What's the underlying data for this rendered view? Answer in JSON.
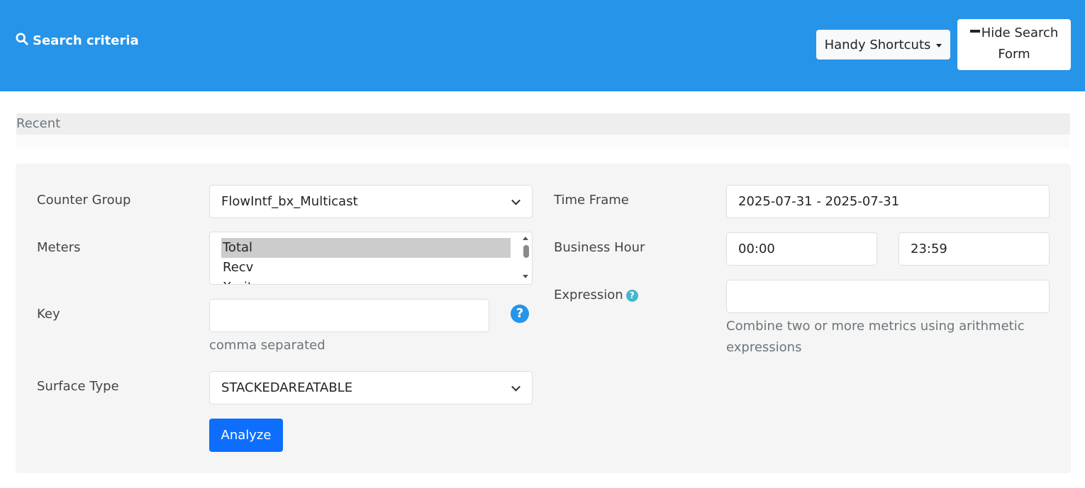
{
  "header": {
    "title": "Search criteria",
    "shortcuts_label": "Handy Shortcuts",
    "hide_label": "Hide Search Form"
  },
  "recent": {
    "label": "Recent"
  },
  "form": {
    "counter_group": {
      "label": "Counter Group",
      "value": "FlowIntf_bx_Multicast"
    },
    "meters": {
      "label": "Meters",
      "options": [
        "Total",
        "Recv",
        "Xmit"
      ],
      "selected": "Total"
    },
    "key": {
      "label": "Key",
      "value": "",
      "hint": "comma separated",
      "help": "?"
    },
    "surface_type": {
      "label": "Surface Type",
      "value": "STACKEDAREATABLE"
    },
    "time_frame": {
      "label": "Time Frame",
      "value": "2025-07-31 - 2025-07-31"
    },
    "business_hour": {
      "label": "Business Hour",
      "start": "00:00",
      "end": "23:59"
    },
    "expression": {
      "label": "Expression",
      "value": "",
      "help": "?",
      "hint": "Combine two or more metrics using arithmetic expressions"
    },
    "analyze_label": "Analyze"
  },
  "colors": {
    "header_bg": "#2694e8",
    "primary_button": "#0d6efd",
    "panel_bg": "#f4f5f4",
    "help_icon": "#2694e8",
    "help_icon_small": "#45b6cf"
  },
  "icons": [
    "search-icon",
    "caret-down-icon",
    "minus-icon",
    "chevron-down-icon",
    "question-circle-icon"
  ]
}
